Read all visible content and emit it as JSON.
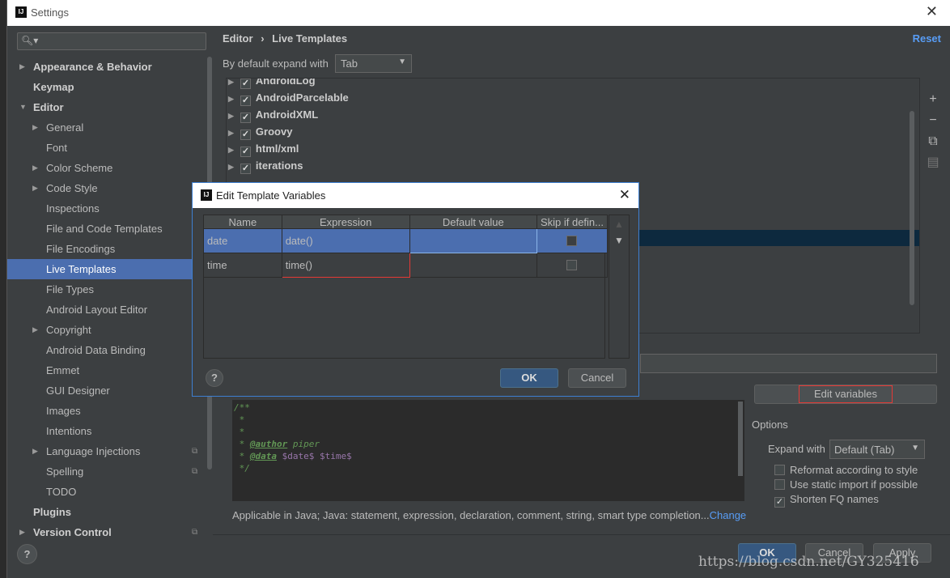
{
  "window": {
    "title": "Settings"
  },
  "sidebar": {
    "search_placeholder": "",
    "items": [
      {
        "label": "Appearance & Behavior",
        "level": 0,
        "arrow": "▶",
        "bold": true
      },
      {
        "label": "Keymap",
        "level": 0,
        "arrow": "",
        "bold": true
      },
      {
        "label": "Editor",
        "level": 0,
        "arrow": "▼",
        "bold": true
      },
      {
        "label": "General",
        "level": 1,
        "arrow": "▶"
      },
      {
        "label": "Font",
        "level": 1,
        "arrow": ""
      },
      {
        "label": "Color Scheme",
        "level": 1,
        "arrow": "▶"
      },
      {
        "label": "Code Style",
        "level": 1,
        "arrow": "▶"
      },
      {
        "label": "Inspections",
        "level": 1,
        "arrow": ""
      },
      {
        "label": "File and Code Templates",
        "level": 1,
        "arrow": ""
      },
      {
        "label": "File Encodings",
        "level": 1,
        "arrow": ""
      },
      {
        "label": "Live Templates",
        "level": 1,
        "arrow": "",
        "selected": true
      },
      {
        "label": "File Types",
        "level": 1,
        "arrow": ""
      },
      {
        "label": "Android Layout Editor",
        "level": 1,
        "arrow": ""
      },
      {
        "label": "Copyright",
        "level": 1,
        "arrow": "▶"
      },
      {
        "label": "Android Data Binding",
        "level": 1,
        "arrow": ""
      },
      {
        "label": "Emmet",
        "level": 1,
        "arrow": ""
      },
      {
        "label": "GUI Designer",
        "level": 1,
        "arrow": ""
      },
      {
        "label": "Images",
        "level": 1,
        "arrow": ""
      },
      {
        "label": "Intentions",
        "level": 1,
        "arrow": ""
      },
      {
        "label": "Language Injections",
        "level": 1,
        "arrow": "▶"
      },
      {
        "label": "Spelling",
        "level": 1,
        "arrow": ""
      },
      {
        "label": "TODO",
        "level": 1,
        "arrow": ""
      },
      {
        "label": "Plugins",
        "level": 0,
        "arrow": "",
        "bold": true
      },
      {
        "label": "Version Control",
        "level": 0,
        "arrow": "▶",
        "bold": true
      }
    ]
  },
  "header": {
    "breadcrumb_parent": "Editor",
    "breadcrumb_sep": "›",
    "breadcrumb_current": "Live Templates",
    "reset": "Reset"
  },
  "expand_default": {
    "label": "By default expand with",
    "value": "Tab"
  },
  "template_groups": [
    "AndroidLog",
    "AndroidParcelable",
    "AndroidXML",
    "Groovy",
    "html/xml",
    "iterations"
  ],
  "edit_variables": "Edit variables",
  "code": {
    "l1": "/**",
    "l2": " *",
    "l3": " *",
    "l4_star": " * ",
    "l4_tag": "@author",
    "l4_rest": " piper",
    "l5_star": " * ",
    "l5_tag": "@data",
    "l5_rest": " $date$ $time$",
    "l6": " */"
  },
  "options": {
    "title": "Options",
    "expand_label": "Expand with",
    "expand_value": "Default (Tab)",
    "checks": [
      {
        "label": "Reformat according to style",
        "checked": false
      },
      {
        "label": "Use static import if possible",
        "checked": false
      },
      {
        "label": "Shorten FQ names",
        "checked": true
      }
    ]
  },
  "applicable": {
    "text": "Applicable in Java; Java: statement, expression, declaration, comment, string, smart type completion...",
    "link": "Change"
  },
  "footer": {
    "ok": "OK",
    "cancel": "Cancel",
    "apply": "Apply",
    "help": "?"
  },
  "watermark": "https://blog.csdn.net/GY325416",
  "dialog": {
    "title": "Edit Template Variables",
    "columns": [
      "Name",
      "Expression",
      "Default value",
      "Skip if defin..."
    ],
    "rows": [
      {
        "name": "date",
        "expression": "date()",
        "default": "",
        "skip": false
      },
      {
        "name": "time",
        "expression": "time()",
        "default": "",
        "skip": false
      }
    ],
    "ok": "OK",
    "cancel": "Cancel",
    "help": "?"
  },
  "colors": {
    "accent": "#4b6eaf",
    "highlight_border": "#e53935",
    "link": "#589df6"
  }
}
